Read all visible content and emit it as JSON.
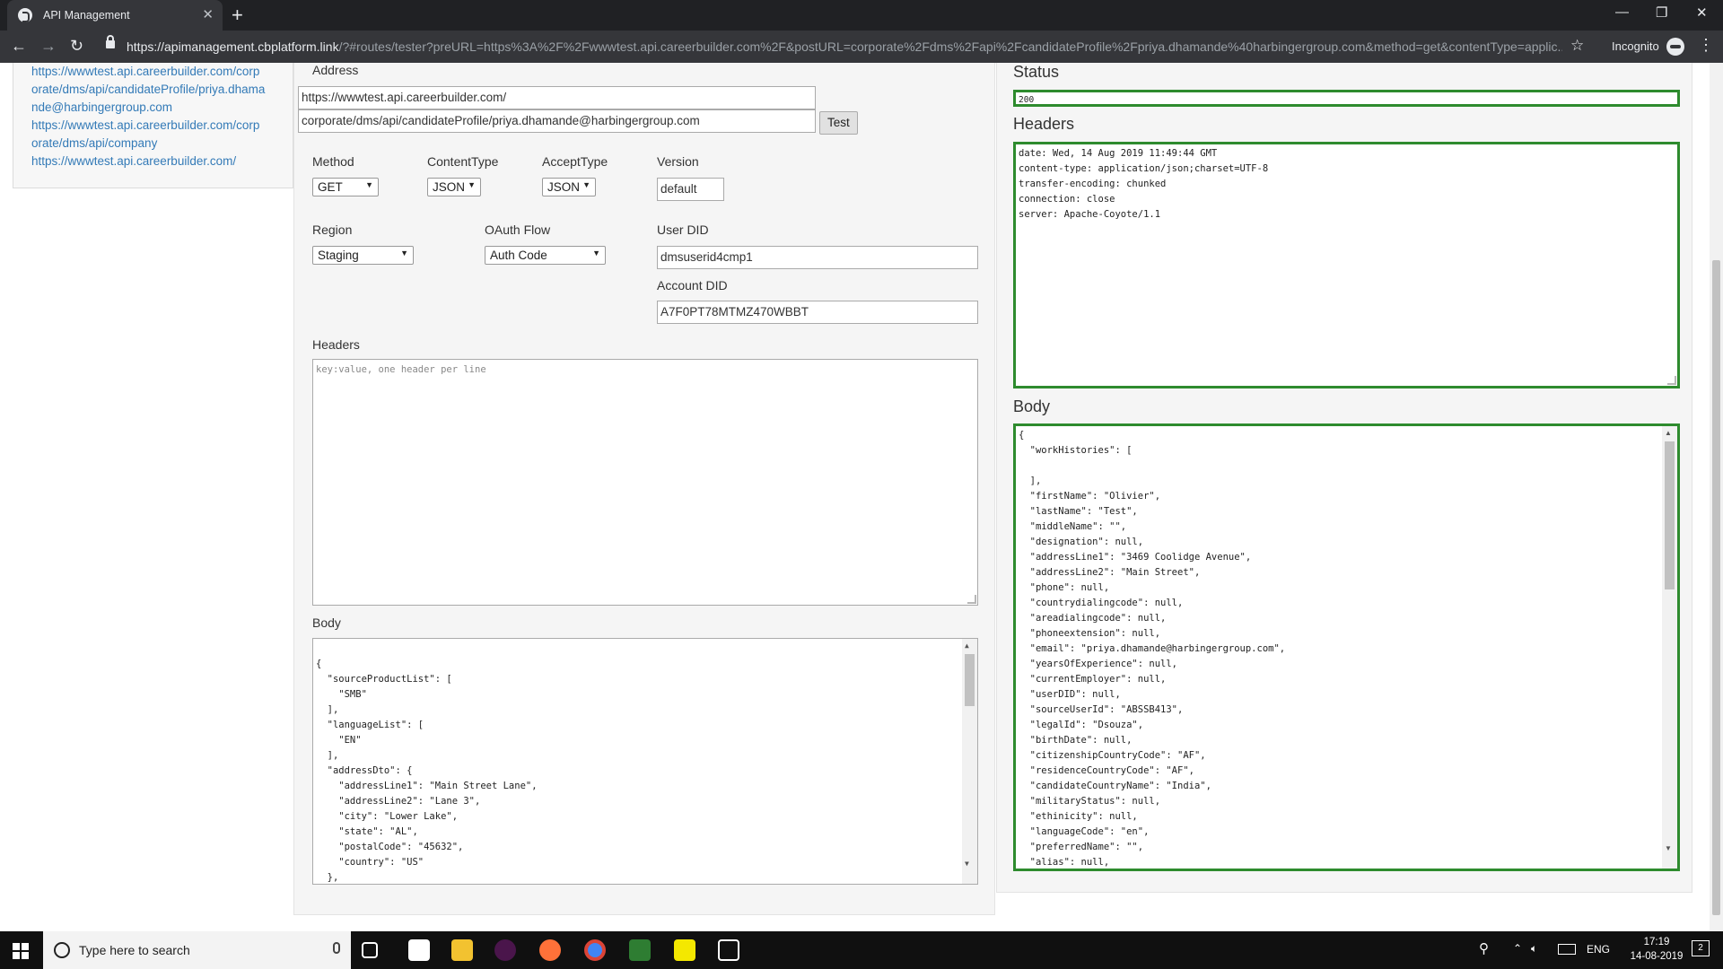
{
  "browser": {
    "tab_title": "API Management",
    "tab_close": "✕",
    "new_tab": "+",
    "url_host": "https://apimanagement.cbplatform.link",
    "url_rest": "/?#routes/tester?preURL=https%3A%2F%2Fwwwtest.api.careerbuilder.com%2F&postURL=corporate%2Fdms%2Fapi%2FcandidateProfile%2Fpriya.dhamande%40harbingergroup.com&method=get&contentType=applic...",
    "profile_label": "Incognito",
    "controls": {
      "minimize": "—",
      "restore": "❐",
      "close": "✕",
      "back": "←",
      "forward": "→",
      "reload": "↻",
      "star": "☆",
      "menu": "⋮"
    }
  },
  "sidebar": {
    "links": [
      "https://wwwtest.api.careerbuilder.com/corp",
      "orate/dms/api/candidateProfile/priya.dhama",
      "nde@harbingergroup.com",
      "https://wwwtest.api.careerbuilder.com/corp",
      "orate/dms/api/company",
      "https://wwwtest.api.careerbuilder.com/"
    ]
  },
  "form": {
    "address_label": "Address",
    "base_url": "https://wwwtest.api.careerbuilder.com/",
    "path": "corporate/dms/api/candidateProfile/priya.dhamande@harbingergroup.com",
    "test_button": "Test",
    "method_label": "Method",
    "method_value": "GET",
    "content_type_label": "ContentType",
    "content_type_value": "JSON",
    "accept_type_label": "AcceptType",
    "accept_type_value": "JSON",
    "version_label": "Version",
    "version_value": "default",
    "region_label": "Region",
    "region_value": "Staging",
    "oauth_label": "OAuth Flow",
    "oauth_value": "Auth Code",
    "user_did_label": "User DID",
    "user_did_value": "dmsuserid4cmp1",
    "account_did_label": "Account DID",
    "account_did_value": "A7F0PT78MTMZ470WBBT",
    "headers_label": "Headers",
    "headers_placeholder": "key:value, one header per line",
    "body_label": "Body",
    "body_text": "{\n  \"sourceProductList\": [\n    \"SMB\"\n  ],\n  \"languageList\": [\n    \"EN\"\n  ],\n  \"addressDto\": {\n    \"addressLine1\": \"Main Street Lane\",\n    \"addressLine2\": \"Lane 3\",\n    \"city\": \"Lower Lake\",\n    \"state\": \"AL\",\n    \"postalCode\": \"45632\",\n    \"country\": \"US\"\n  },"
  },
  "response": {
    "status_label": "Status",
    "status_value": "200",
    "headers_label": "Headers",
    "headers_text": "date: Wed, 14 Aug 2019 11:49:44 GMT\ncontent-type: application/json;charset=UTF-8\ntransfer-encoding: chunked\nconnection: close\nserver: Apache-Coyote/1.1",
    "body_label": "Body",
    "body_text": "{\n  \"workHistories\": [\n\n  ],\n  \"firstName\": \"Olivier\",\n  \"lastName\": \"Test\",\n  \"middleName\": \"\",\n  \"designation\": null,\n  \"addressLine1\": \"3469 Coolidge Avenue\",\n  \"addressLine2\": \"Main Street\",\n  \"phone\": null,\n  \"countrydialingcode\": null,\n  \"areadialingcode\": null,\n  \"phoneextension\": null,\n  \"email\": \"priya.dhamande@harbingergroup.com\",\n  \"yearsOfExperience\": null,\n  \"currentEmployer\": null,\n  \"userDID\": null,\n  \"sourceUserId\": \"ABSSB413\",\n  \"legalId\": \"Dsouza\",\n  \"birthDate\": null,\n  \"citizenshipCountryCode\": \"AF\",\n  \"residenceCountryCode\": \"AF\",\n  \"candidateCountryName\": \"India\",\n  \"militaryStatus\": null,\n  \"ethinicity\": null,\n  \"languageCode\": \"en\",\n  \"preferredName\": \"\",\n  \"alias\": null,"
  },
  "taskbar": {
    "search_placeholder": "Type here to search",
    "language": "ENG",
    "time": "17:19",
    "date": "14-08-2019",
    "notification_count": "2"
  },
  "colors": {
    "success_border": "#2e8b2e",
    "link": "#337ab7",
    "chrome_dark": "#202124"
  }
}
